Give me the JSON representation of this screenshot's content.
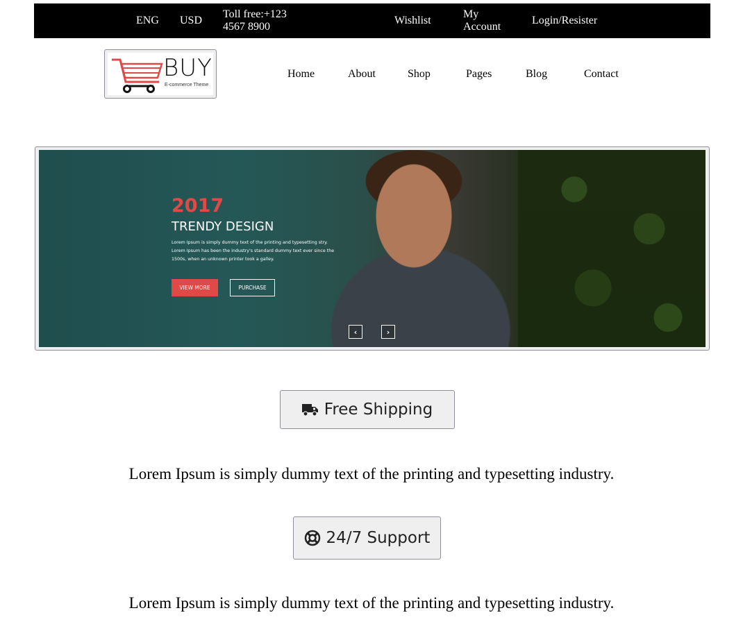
{
  "topbar": {
    "language": "ENG",
    "currency": "USD",
    "toll_free": "Toll free:+123 4567 8900",
    "wishlist": "Wishlist",
    "my_account": "My Account",
    "login_register": "Login/Resister"
  },
  "logo": {
    "brand": "BUY",
    "tagline": "E-commerce Theme",
    "icon": "shopping-cart-icon",
    "accent_color": "#e04a46"
  },
  "nav": {
    "items": [
      "Home",
      "About",
      "Shop",
      "Pages",
      "Blog",
      "Contact"
    ]
  },
  "hero": {
    "year": "2017",
    "title": "TRENDY DESIGN",
    "description": "Lorem Ipsum is simply dummy text of the printing and typesetting stry. Lorem Ipsum has been the industry's standard dummy text ever since the 1500s, when an unknown printer took a galley.",
    "view_more": "VIEW MORE",
    "purchase": "PURCHASE",
    "prev_icon": "chevron-left-icon",
    "next_icon": "chevron-right-icon",
    "prev_glyph": "‹",
    "next_glyph": "›"
  },
  "features": [
    {
      "label": "Free Shipping",
      "icon": "truck-icon",
      "text": "Lorem Ipsum is simply dummy text of the printing and typesetting industry."
    },
    {
      "label": "24/7 Support",
      "icon": "life-ring-icon",
      "text": "Lorem Ipsum is simply dummy text of the printing and typesetting industry."
    }
  ]
}
